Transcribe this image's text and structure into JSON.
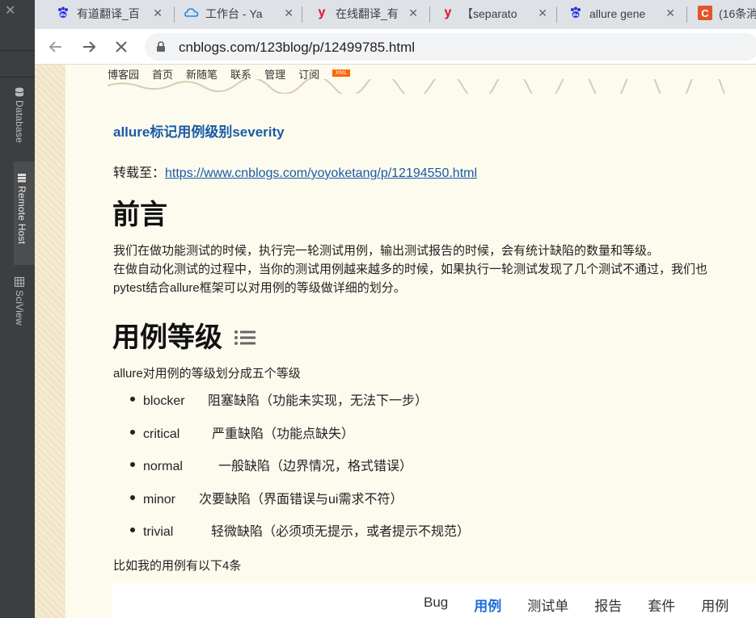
{
  "ide": {
    "close_glyph": "✕",
    "tabs": [
      {
        "label": "Database"
      },
      {
        "label": "Remote Host"
      },
      {
        "label": "SciView"
      }
    ]
  },
  "browser": {
    "tabs": [
      {
        "title": "有道翻译_百",
        "favicon": "paw-icon",
        "favicon_color": "#2932e1"
      },
      {
        "title": "工作台 - Ya",
        "favicon": "cloud-icon",
        "favicon_color": "#1e88e5"
      },
      {
        "title": "在线翻译_有",
        "favicon": "y-icon",
        "favicon_color": "#e0112f"
      },
      {
        "title": "【separato",
        "favicon": "y-icon",
        "favicon_color": "#e0112f"
      },
      {
        "title": "allure gene",
        "favicon": "paw-icon",
        "favicon_color": "#2932e1"
      },
      {
        "title": "(16条消",
        "favicon": "c-icon",
        "favicon_color": "#e4532b"
      }
    ],
    "tab_close_glyph": "✕",
    "url": "cnblogs.com/123blog/p/12499785.html"
  },
  "blog_nav": {
    "items": [
      "博客园",
      "首页",
      "新随笔",
      "联系",
      "管理",
      "订阅"
    ],
    "xml_badge": "XML"
  },
  "post": {
    "title": "allure标记用例级别severity",
    "repost_label": "转载至：",
    "repost_url": "https://www.cnblogs.com/yoyoketang/p/12194550.html",
    "h_preface": "前言",
    "p1": "我们在做功能测试的时候，执行完一轮测试用例，输出测试报告的时候，会有统计缺陷的数量和等级。",
    "p2": "在做自动化测试的过程中，当你的测试用例越来越多的时候，如果执行一轮测试发现了几个测试不通过，我们也",
    "p3": "pytest结合allure框架可以对用例的等级做详细的划分。",
    "h_levels": "用例等级",
    "levels_intro": "allure对用例的等级划分成五个等级",
    "levels": [
      {
        "name": "blocker",
        "desc": "阻塞缺陷（功能未实现，无法下一步）"
      },
      {
        "name": "critical",
        "desc": "严重缺陷（功能点缺失）"
      },
      {
        "name": "normal",
        "desc": "一般缺陷（边界情况，格式错误）"
      },
      {
        "name": "minor",
        "desc": "次要缺陷（界面错误与ui需求不符）"
      },
      {
        "name": "trivial",
        "desc": "轻微缺陷（必须项无提示，或者提示不规范）"
      }
    ],
    "examples_intro": "比如我的用例有以下4条"
  },
  "zentao_tabs": {
    "items": [
      "Bug",
      "用例",
      "测试单",
      "报告",
      "套件",
      "用例"
    ],
    "active_index": 1
  },
  "colors": {
    "link": "#1a5aa6",
    "active_tab": "#1a6dd8"
  }
}
